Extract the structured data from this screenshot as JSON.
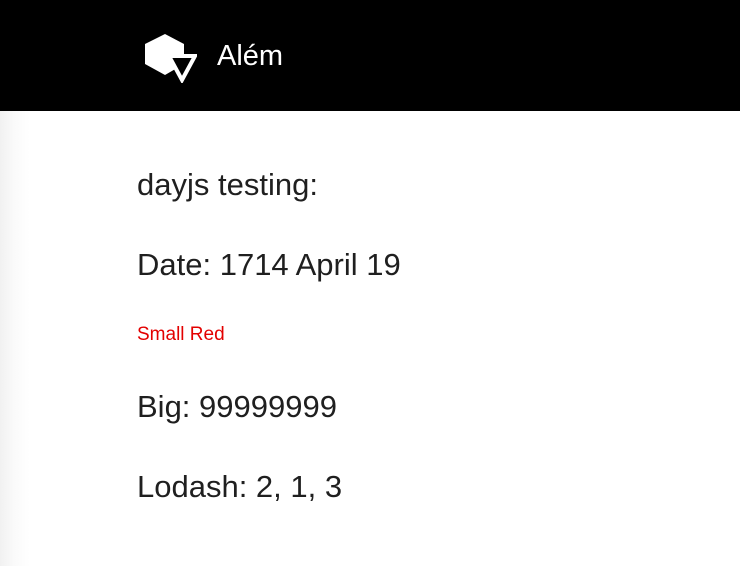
{
  "header": {
    "logo_icon": "hexagon-triangle-logo-icon",
    "title": "Além",
    "background": "#000000"
  },
  "main": {
    "heading": "dayjs testing:",
    "date_line": "Date: 1714 April 19",
    "small_red": "Small Red",
    "small_red_color": "#e30000",
    "big_line": "Big: 99999999",
    "lodash_line": "Lodash: 2, 1, 3"
  }
}
